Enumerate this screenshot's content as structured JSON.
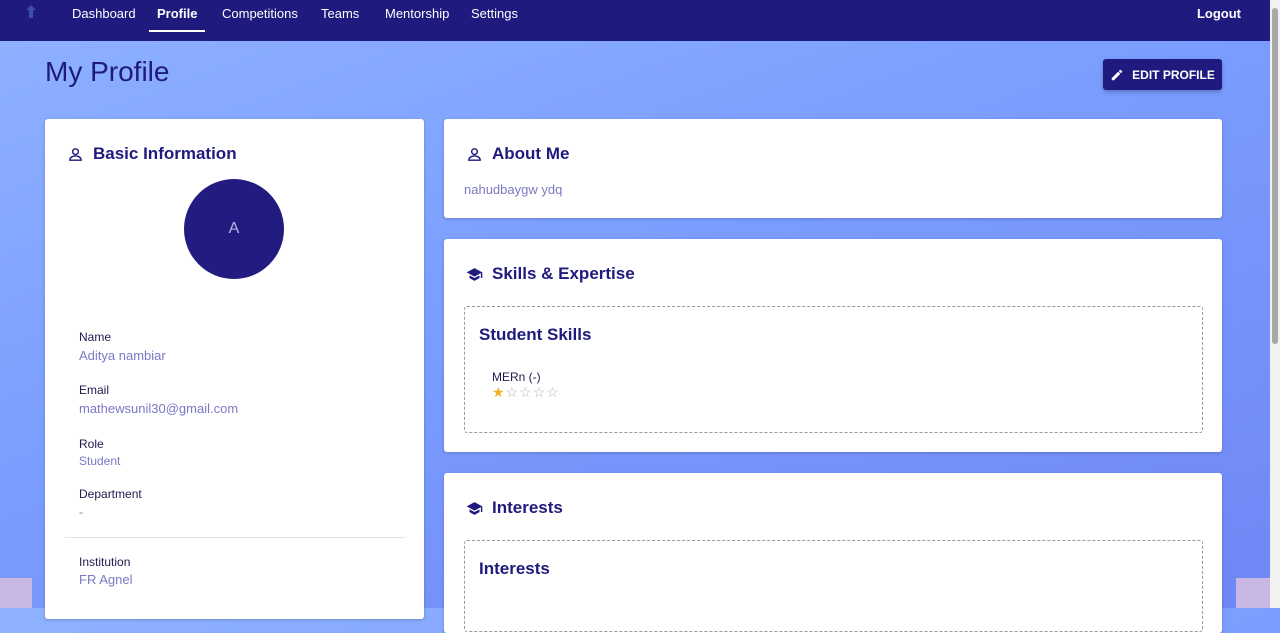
{
  "nav": {
    "items": [
      {
        "label": "Dashboard"
      },
      {
        "label": "Profile"
      },
      {
        "label": "Competitions"
      },
      {
        "label": "Teams"
      },
      {
        "label": "Mentorship"
      },
      {
        "label": "Settings"
      }
    ],
    "active_index": 1,
    "logout_label": "Logout"
  },
  "page": {
    "title": "My Profile",
    "edit_button_label": "EDIT PROFILE"
  },
  "basic_info": {
    "title": "Basic Information",
    "avatar_initial": "A",
    "fields": {
      "name": {
        "label": "Name",
        "value": "Aditya nambiar"
      },
      "email": {
        "label": "Email",
        "value": "mathewsunil30@gmail.com"
      },
      "role": {
        "label": "Role",
        "value": "Student"
      },
      "department": {
        "label": "Department",
        "value": "-"
      },
      "institution": {
        "label": "Institution",
        "value": "FR Agnel"
      }
    }
  },
  "about": {
    "title": "About Me",
    "text": "nahudbaygw ydq"
  },
  "skills": {
    "title": "Skills & Expertise",
    "section_title": "Student Skills",
    "items": [
      {
        "name": "MERn (-)",
        "rating": 1,
        "max_rating": 5
      }
    ]
  },
  "interests": {
    "title": "Interests",
    "section_title": "Interests"
  },
  "colors": {
    "primary": "#1f1a7d",
    "accent_text": "#7b78c4",
    "star": "#f2b01e"
  }
}
